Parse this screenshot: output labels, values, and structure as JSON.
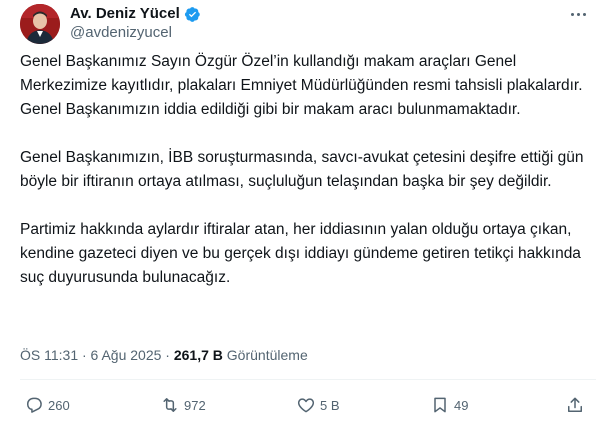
{
  "author": {
    "display_name": "Av. Deniz Yücel",
    "handle": "@avdenizyucel",
    "verified_color": "#1d9bf0"
  },
  "tweet": {
    "paragraphs": [
      "Genel Başkanımız Sayın Özgür Özel’in kullandığı makam araçları Genel Merkezimize kayıtlıdır, plakaları Emniyet Müdürlüğünden resmi tahsisli plakalardır. Genel Başkanımızın iddia edildiği gibi bir makam aracı bulunmamaktadır.",
      "Genel Başkanımızın, İBB soruşturmasında, savcı-avukat çetesini deşifre ettiği gün böyle bir iftiranın ortaya atılması, suçluluğun telaşından başka bir şey değildir.",
      "Partimiz hakkında aylardır iftiralar atan, her iddiasının yalan olduğu ortaya çıkan, kendine gazeteci diyen ve bu gerçek dışı iddiayı gündeme getiren tetikçi hakkında suç duyurusunda bulunacağız."
    ],
    "timestamp": "ÖS 11:31 · 6 Ağu 2025",
    "separator": " · ",
    "views_count": "261,7 B",
    "views_label": "Görüntüleme"
  },
  "actions": {
    "reply_count": "260",
    "retweet_count": "972",
    "like_count": "5 B",
    "bookmark_count": "49",
    "icons": [
      "reply-icon",
      "retweet-icon",
      "like-icon",
      "bookmark-icon",
      "share-icon"
    ]
  }
}
